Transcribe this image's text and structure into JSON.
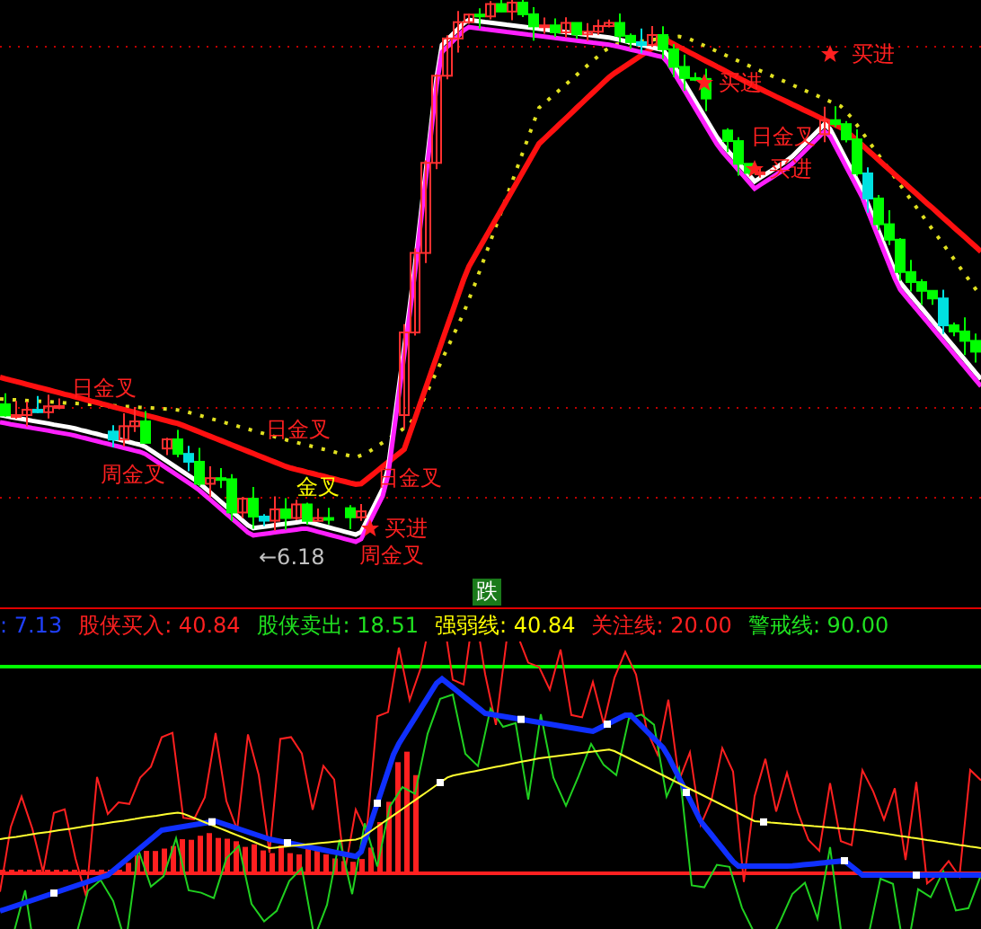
{
  "chart_labels": [
    {
      "text": "日金叉",
      "color": "#ff2020"
    },
    {
      "text": "周金叉",
      "color": "#ff2020"
    },
    {
      "text": "日金叉",
      "color": "#ff2020"
    },
    {
      "text": "日金叉",
      "color": "#ff2020"
    },
    {
      "text": "买进",
      "color": "#ff2020"
    },
    {
      "text": "周金叉",
      "color": "#ff2020"
    },
    {
      "text": "金叉",
      "color": "#ffff00"
    },
    {
      "text": "买进",
      "color": "#ff2020"
    },
    {
      "text": "买进",
      "color": "#ff2020"
    },
    {
      "text": "日金叉",
      "color": "#ff2020"
    },
    {
      "text": "买进",
      "color": "#ff2020"
    }
  ],
  "price_marker": "←6.18",
  "indicator_badge": "跌",
  "legend": [
    {
      "text": ": 7.13",
      "color": "#2040ff"
    },
    {
      "text": "股侠买入: 40.84",
      "color": "#ff2020"
    },
    {
      "text": "股侠卖出: 18.51",
      "color": "#20e020"
    },
    {
      "text": "强弱线: 40.84",
      "color": "#ffff00"
    },
    {
      "text": "关注线: 20.00",
      "color": "#ff2020"
    },
    {
      "text": "警戒线: 90.00",
      "color": "#20e020"
    }
  ]
}
